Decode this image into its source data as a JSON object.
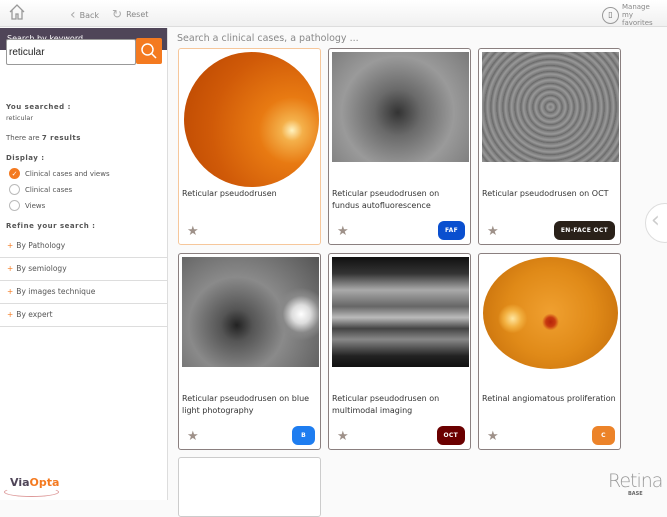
{
  "topbar": {
    "back": "Back",
    "reset": "Reset",
    "favorites": "Manage my favorites"
  },
  "sidebar": {
    "header": "Search by keyword",
    "search_value": "reticular",
    "you_searched_label": "You searched :",
    "you_searched_value": "reticular",
    "results_prefix": "There are",
    "results_count": "7 results",
    "display_label": "Display :",
    "display_options": [
      {
        "label": "Clinical cases and views",
        "selected": true
      },
      {
        "label": "Clinical cases",
        "selected": false
      },
      {
        "label": "Views",
        "selected": false
      }
    ],
    "refine_label": "Refine your search :",
    "refine_items": [
      "By Pathology",
      "By semiology",
      "By images technique",
      "By expert"
    ],
    "logo": "ViaOpta"
  },
  "main": {
    "hint": "Search a clinical cases, a pathology ...",
    "cards": [
      {
        "title": "Reticular pseudodrusen",
        "badge": "",
        "badge_color": ""
      },
      {
        "title": "Reticular pseudodrusen on fundus autofluorescence",
        "badge": "FAF",
        "badge_color": "#0a4fcf"
      },
      {
        "title": "Reticular pseudodrusen on OCT",
        "badge": "EN-FACE OCT",
        "badge_color": "#2a2119"
      },
      {
        "title": "Reticular pseudodrusen on blue light photography",
        "badge": "B",
        "badge_color": "#1e7df0"
      },
      {
        "title": "Reticular pseudodrusen on multimodal imaging",
        "badge": "OCT",
        "badge_color": "#6b0000"
      },
      {
        "title": "Retinal angiomatous proliferation",
        "badge": "C",
        "badge_color": "#ec8329"
      }
    ],
    "brand": "Retina",
    "brand_sub": "BASE"
  }
}
